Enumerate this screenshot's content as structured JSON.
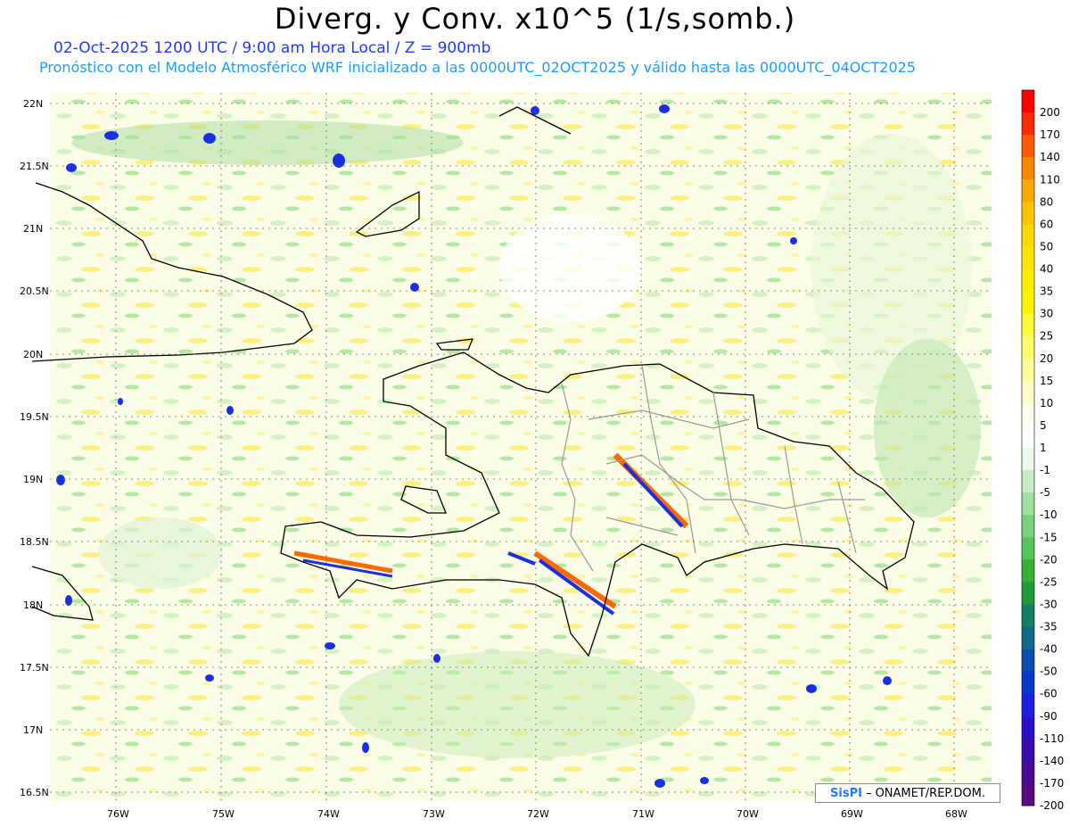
{
  "title": "Diverg. y Conv. x10^5 (1/s,somb.)",
  "subtitle_line1": "02-Oct-2025  1200 UTC / 9:00 am Hora Local / Z = 900mb",
  "subtitle_line2": "Pronóstico con el Modelo Atmosférico WRF inicializado a las 0000UTC_02OCT2025 y válido hasta las  0000UTC_04OCT2025",
  "lat_labels": [
    "22N",
    "21.5N",
    "21N",
    "20.5N",
    "20N",
    "19.5N",
    "19N",
    "18.5N",
    "18N",
    "17.5N",
    "17N",
    "16.5N"
  ],
  "lon_labels": [
    "76W",
    "75W",
    "74W",
    "73W",
    "72W",
    "71W",
    "70W",
    "69W",
    "68W"
  ],
  "colorbar": {
    "labels": [
      "200",
      "170",
      "140",
      "110",
      "80",
      "60",
      "50",
      "40",
      "35",
      "30",
      "25",
      "20",
      "15",
      "10",
      "5",
      "1",
      "-1",
      "-5",
      "-10",
      "-15",
      "-20",
      "-25",
      "-30",
      "-35",
      "-40",
      "-50",
      "-60",
      "-90",
      "-110",
      "-140",
      "-170",
      "-200"
    ],
    "colors": [
      "#ff0000",
      "#ff2a00",
      "#ff5a00",
      "#ff8400",
      "#ffa800",
      "#ffc400",
      "#ffd800",
      "#ffe400",
      "#ffee00",
      "#fff400",
      "#fffa33",
      "#ffff66",
      "#ffff99",
      "#ffffc8",
      "#fffff0",
      "#ffffff",
      "#eef8ee",
      "#c8ecc8",
      "#a0e0a0",
      "#7cd27c",
      "#58c458",
      "#36b036",
      "#1e9a3a",
      "#138066",
      "#0e6a88",
      "#0a4eb0",
      "#0a36d0",
      "#1a1ee0",
      "#2a10cc",
      "#3a0cb0",
      "#4a0a96",
      "#5a0a80"
    ]
  },
  "credit": {
    "logo": "SisPI",
    "org": "– ONAMET/REP.DOM."
  }
}
